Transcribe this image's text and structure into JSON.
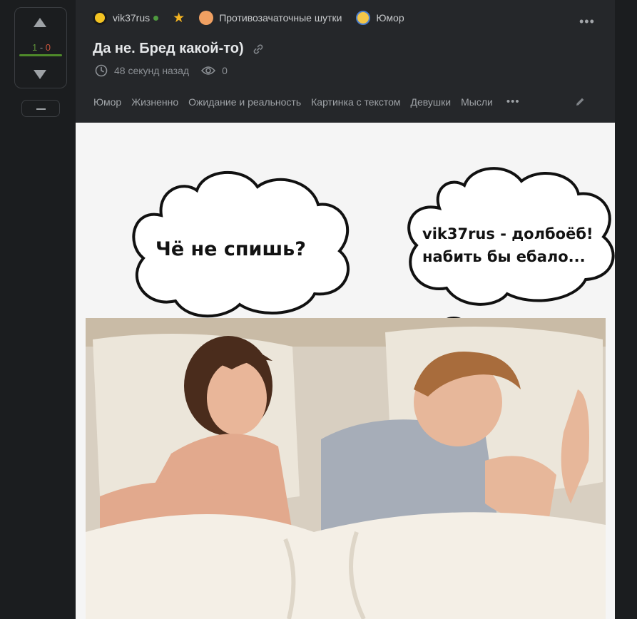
{
  "vote": {
    "plus": "1",
    "separator": " - ",
    "minus": "0",
    "positive_ratio": 1.0
  },
  "author": {
    "name": "vik37rus",
    "online": true
  },
  "community": "Противозачаточные шутки",
  "category": "Юмор",
  "post": {
    "title": "Да не. Бред какой-то)",
    "time": "48 секунд назад",
    "views": "0"
  },
  "tags": [
    "Юмор",
    "Жизненно",
    "Ожидание и реальность",
    "Картинка с текстом",
    "Девушки",
    "Мысли"
  ],
  "meme": {
    "left_bubble": "Чё не спишь?",
    "right_bubble_line1": "vik37rus - долбоёб!",
    "right_bubble_line2": "набить бы ебало..."
  },
  "icons": {
    "vote_up": "triangle-up-icon",
    "vote_down": "triangle-down-icon",
    "collapse": "minus-icon",
    "favorite": "star-icon",
    "link": "link-icon",
    "time": "clock-icon",
    "views": "eye-icon",
    "menu": "more-dots-icon",
    "edit": "pencil-icon"
  },
  "colors": {
    "background": "#1b1d1f",
    "card": "#25272a",
    "vote_plus": "#5e8f3a",
    "vote_minus": "#c9543c",
    "online": "#4f9a3f",
    "star": "#f3b321"
  }
}
